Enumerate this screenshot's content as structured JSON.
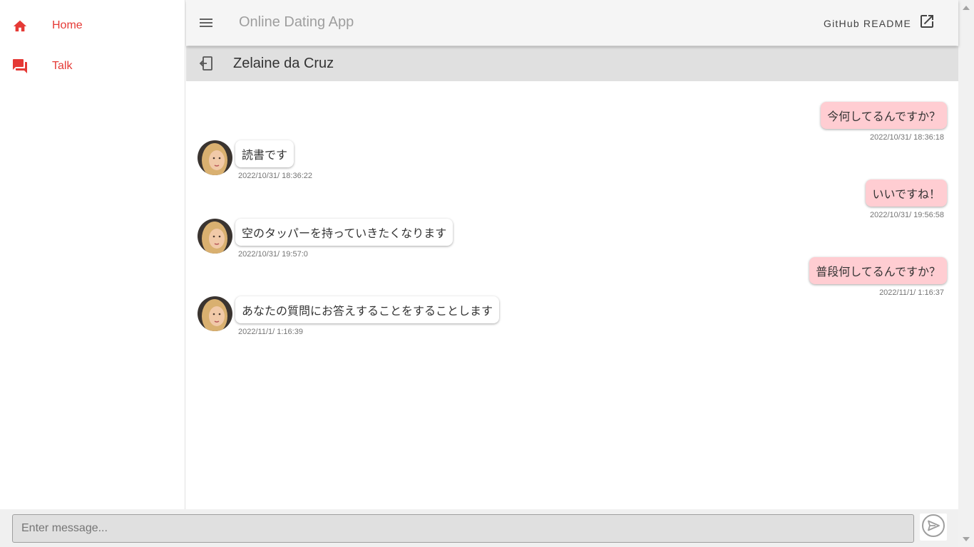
{
  "nav": {
    "items": [
      {
        "label": "Home",
        "icon": "home-icon"
      },
      {
        "label": "Talk",
        "icon": "forum-icon"
      }
    ]
  },
  "appbar": {
    "title": "Online Dating App",
    "readme_label": "GitHub README"
  },
  "chat": {
    "partner_name": "Zelaine da Cruz",
    "messages": [
      {
        "from": "me",
        "text": "今何してるんですか？",
        "time": "2022/10/31/ 18:36:18"
      },
      {
        "from": "partner",
        "text": "読書です",
        "time": "2022/10/31/ 18:36:22"
      },
      {
        "from": "me",
        "text": "いいですね！",
        "time": "2022/10/31/ 19:56:58"
      },
      {
        "from": "partner",
        "text": "空のタッパーを持っていきたくなります",
        "time": "2022/10/31/ 19:57:0"
      },
      {
        "from": "me",
        "text": "普段何してるんですか？",
        "time": "2022/11/1/ 1:16:37"
      },
      {
        "from": "partner",
        "text": "あなたの質問にお答えすることをすることします",
        "time": "2022/11/1/ 1:16:39"
      }
    ]
  },
  "composer": {
    "placeholder": "Enter message...",
    "value": ""
  },
  "colors": {
    "accent": "#e53935",
    "my_bubble": "#ffcdd2",
    "appbar_bg": "#f5f5f5",
    "header_bg": "#e0e0e0"
  }
}
